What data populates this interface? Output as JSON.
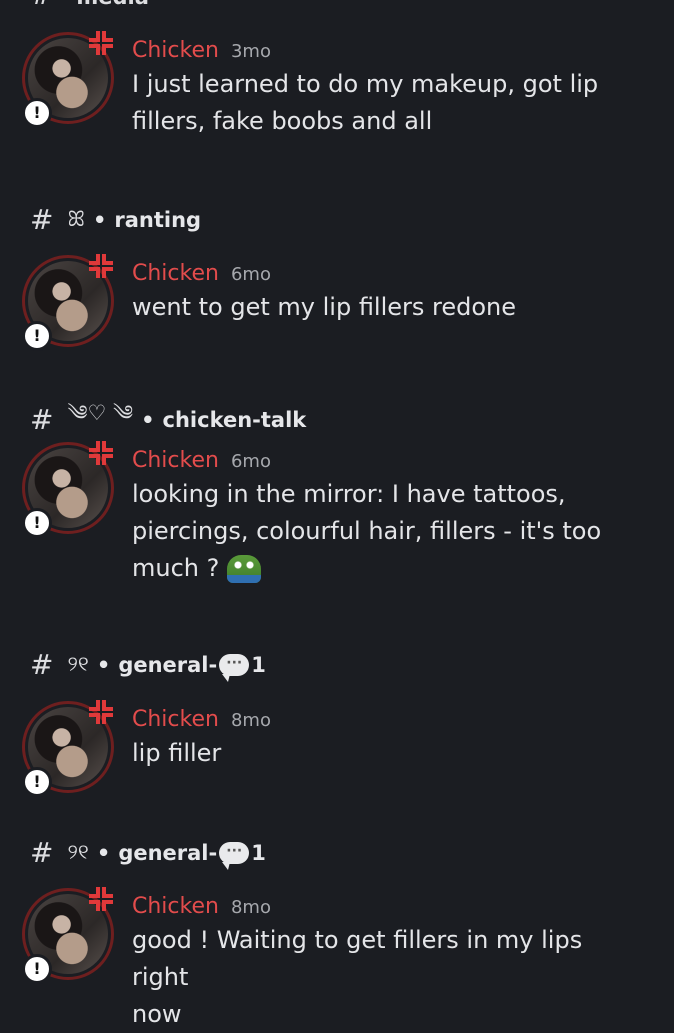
{
  "top_partial": {
    "hash": "#",
    "text": "media"
  },
  "channels": [
    {
      "hash": "#",
      "decoration": "ꕤ",
      "separator": "•",
      "name": "ranting"
    },
    {
      "hash": "#",
      "decoration": "༄♡ ༄",
      "separator": "•",
      "name": "chicken-talk"
    },
    {
      "hash": "#",
      "decoration": "୨୧",
      "separator": "•",
      "name": "general-",
      "bubble": "···",
      "suffix": "1"
    },
    {
      "hash": "#",
      "decoration": "୨୧",
      "separator": "•",
      "name": "general-",
      "bubble": "···",
      "suffix": "1"
    }
  ],
  "messages": [
    {
      "author": "Chicken",
      "time": "3mo",
      "lines": [
        "I just learned to do my makeup, got lip",
        "fillers, fake boobs and all"
      ]
    },
    {
      "author": "Chicken",
      "time": "6mo",
      "lines": [
        "went to get my lip fillers redone"
      ]
    },
    {
      "author": "Chicken",
      "time": "6mo",
      "lines": [
        "looking in the mirror: I have tattoos,",
        "piercings, colourful hair, fillers - it's too",
        "much ?"
      ],
      "emoji": "pepe-emoji"
    },
    {
      "author": "Chicken",
      "time": "8mo",
      "lines": [
        "lip filler"
      ]
    },
    {
      "author": "Chicken",
      "time": "8mo",
      "lines": [
        "good ! Waiting to get fillers in my lips right",
        "now"
      ]
    }
  ],
  "badge": {
    "warn_symbol": "!"
  },
  "colors": {
    "background": "#1b1d22",
    "author": "#e24c4c",
    "timestamp": "#a6a8ad",
    "text": "#e4e5e8"
  }
}
